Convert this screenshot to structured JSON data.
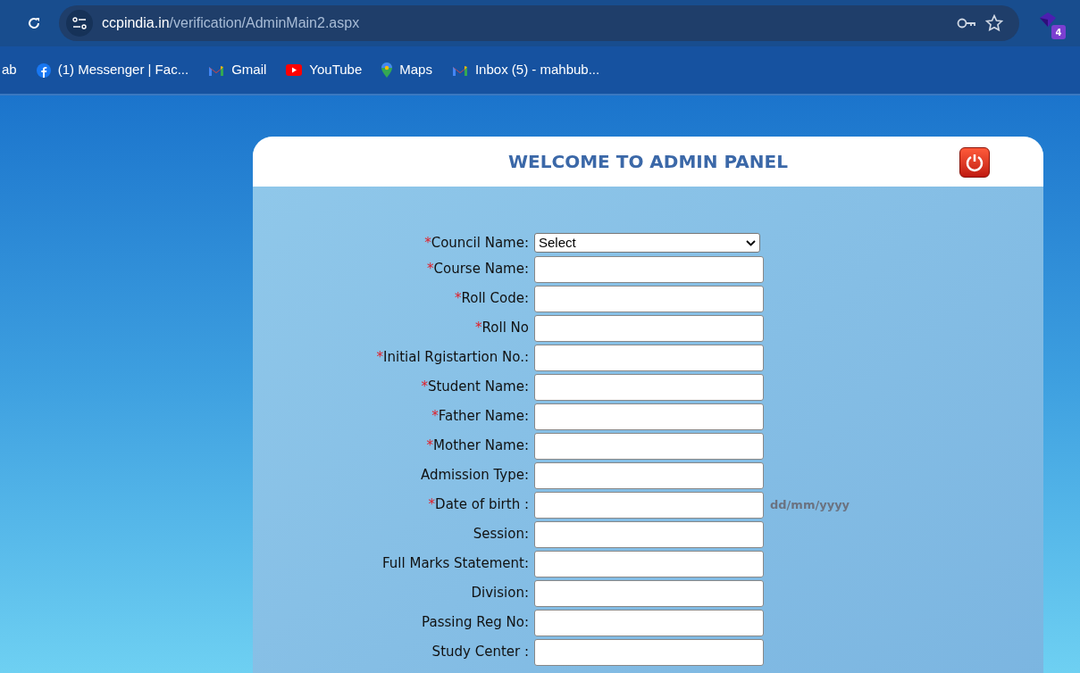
{
  "browser": {
    "url_host": "ccpindia.in",
    "url_path": "/verification/AdminMain2.aspx",
    "extensions_badge": "4"
  },
  "bookmarks": [
    {
      "label": "ab",
      "kind": "plain"
    },
    {
      "label": "(1) Messenger | Fac...",
      "kind": "facebook"
    },
    {
      "label": "Gmail",
      "kind": "gmail"
    },
    {
      "label": "YouTube",
      "kind": "youtube"
    },
    {
      "label": "Maps",
      "kind": "maps"
    },
    {
      "label": "Inbox (5) - mahbub...",
      "kind": "gmail"
    }
  ],
  "panel": {
    "title": "WELCOME TO ADMIN PANEL"
  },
  "form": [
    {
      "marker": "*",
      "label": "Council Name:",
      "kind": "select",
      "value": "Select"
    },
    {
      "marker": "*",
      "label": "Course Name:",
      "kind": "text"
    },
    {
      "marker": "*",
      "label": "Roll Code:",
      "kind": "text"
    },
    {
      "marker": "*",
      "label": "Roll No",
      "kind": "text"
    },
    {
      "marker": "*",
      "label": "Initial Rgistartion No.:",
      "kind": "text"
    },
    {
      "marker": "*",
      "label": "Student Name:",
      "kind": "text"
    },
    {
      "marker": "*",
      "label": "Father Name:",
      "kind": "text"
    },
    {
      "marker": "*",
      "label": "Mother Name:",
      "kind": "text"
    },
    {
      "label": "Admission Type:",
      "kind": "text"
    },
    {
      "marker": "*",
      "label": "Date of birth :",
      "kind": "text",
      "hint": "dd/mm/yyyy"
    },
    {
      "label": "Session:",
      "kind": "text"
    },
    {
      "label": "Full Marks Statement:",
      "kind": "text"
    },
    {
      "label": "Division:",
      "kind": "text"
    },
    {
      "label": "Passing Reg No:",
      "kind": "text"
    },
    {
      "label": "Study Center :",
      "kind": "text"
    }
  ]
}
